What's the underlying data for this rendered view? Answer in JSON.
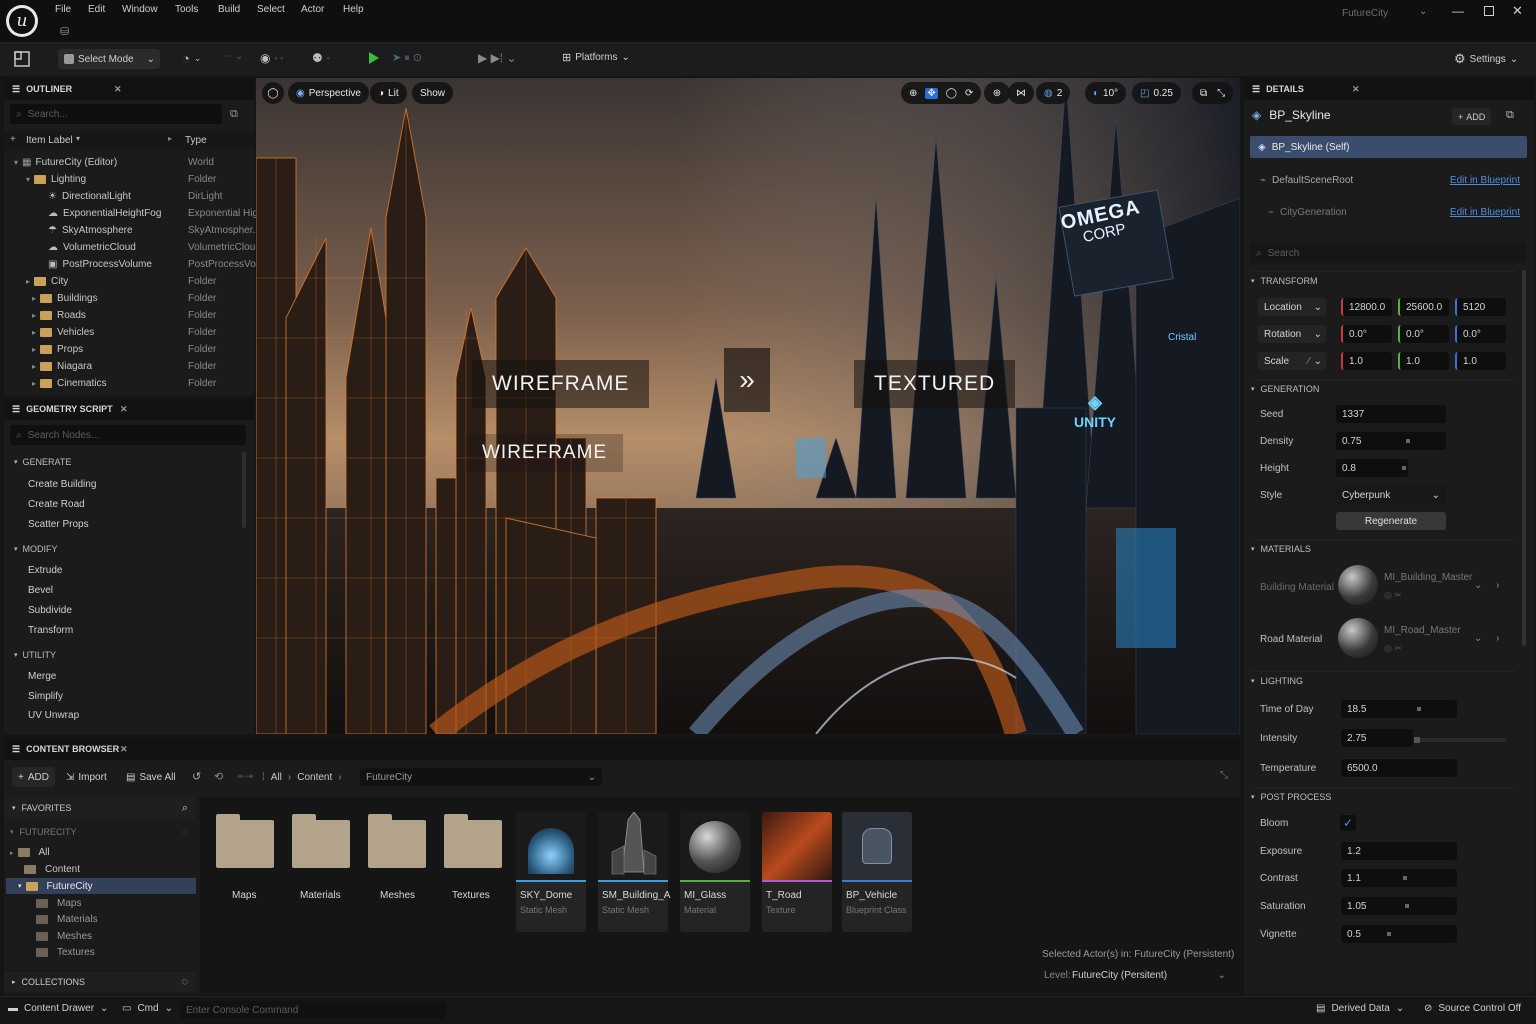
{
  "window": {
    "title": "FutureCity"
  },
  "menus": [
    "File",
    "Edit",
    "Window",
    "Tools",
    "Build",
    "Select",
    "Actor",
    "Help"
  ],
  "toolbar": {
    "select_mode": "Select Mode",
    "platforms": "Platforms",
    "settings": "Settings"
  },
  "outliner": {
    "title": "OUTLINER",
    "search_placeholder": "Search...",
    "col_label": "Item Label",
    "col_type": "Type",
    "rows": [
      {
        "label": "FutureCity (Editor)",
        "type": "World"
      },
      {
        "label": "Lighting",
        "type": "Folder"
      },
      {
        "label": "DirectionalLight",
        "type": "DirLight"
      },
      {
        "label": "ExponentialHeightFog",
        "type": "Exponential Hig"
      },
      {
        "label": "SkyAtmosphere",
        "type": "SkyAtmospher..."
      },
      {
        "label": "VolumetricCloud",
        "type": "VolumetricClou"
      },
      {
        "label": "PostProcessVolume",
        "type": "PostProcessVol"
      },
      {
        "label": "City",
        "type": "Folder"
      },
      {
        "label": "Buildings",
        "type": "Folder"
      },
      {
        "label": "Roads",
        "type": "Folder"
      },
      {
        "label": "Vehicles",
        "type": "Folder"
      },
      {
        "label": "Props",
        "type": "Folder"
      },
      {
        "label": "Niagara",
        "type": "Folder"
      },
      {
        "label": "Cinematics",
        "type": "Folder"
      }
    ]
  },
  "geometry_script": {
    "title": "GEOMETRY SCRIPT",
    "search_placeholder": "Search Nodes...",
    "sections": [
      {
        "name": "GENERATE",
        "items": [
          "Create Building",
          "Create Road",
          "Scatter Props"
        ]
      },
      {
        "name": "MODIFY",
        "items": [
          "Extrude",
          "Bevel",
          "Subdivide",
          "Transform"
        ]
      },
      {
        "name": "UTILITY",
        "items": [
          "Merge",
          "Simplify",
          "UV Unwrap"
        ]
      }
    ]
  },
  "viewport": {
    "perspective": "Perspective",
    "lit": "Lit",
    "show": "Show",
    "snap_grid": "2",
    "snap_angle": "10°",
    "snap_scale": "0.25",
    "label_wireframe": "WIREFRAME",
    "label_wireframe_2": "WIREFRAME",
    "label_textured": "TEXTURED",
    "sign_omega_1": "OMEGA",
    "sign_omega_2": "CORP",
    "sign_unity": "UNITY",
    "sign_small": "Cristal"
  },
  "details": {
    "title": "DETAILS",
    "actor": "BP_Skyline",
    "add": "ADD",
    "self": "BP_Skyline (Self)",
    "components": [
      {
        "name": "DefaultSceneRoot",
        "link": "Edit in Blueprint"
      },
      {
        "name": "CityGeneration",
        "link": "Edit in Blueprint"
      }
    ],
    "search_placeholder": "Search",
    "transform": {
      "title": "TRANSFORM",
      "location_label": "Location",
      "location": [
        "12800.0",
        "25600.0",
        "5120"
      ],
      "rotation_label": "Rotation",
      "rotation": [
        "0.0°",
        "0.0°",
        "0.0°"
      ],
      "scale_label": "Scale",
      "scale": [
        "1.0",
        "1.0",
        "1.0"
      ]
    },
    "generation": {
      "title": "GENERATION",
      "seed_label": "Seed",
      "seed": "1337",
      "density_label": "Density",
      "density": "0.75",
      "height_label": "Height",
      "height": "0.8",
      "style_label": "Style",
      "style": "Cyberpunk",
      "regenerate": "Regenerate"
    },
    "materials": {
      "title": "MATERIALS",
      "building_label": "Building Material",
      "building": "MI_Building_Master",
      "road_label": "Road Material",
      "road": "MI_Road_Master"
    },
    "lighting": {
      "title": "LIGHTING",
      "tod_label": "Time of Day",
      "tod": "18.5",
      "intensity_label": "Intensity",
      "intensity": "2.75",
      "temperature_label": "Temperature",
      "temperature": "6500.0"
    },
    "post_process": {
      "title": "POST PROCESS",
      "bloom_label": "Bloom",
      "exposure_label": "Exposure",
      "exposure": "1.2",
      "contrast_label": "Contrast",
      "contrast": "1.1",
      "saturation_label": "Saturation",
      "saturation": "1.05",
      "vignette_label": "Vignette",
      "vignette": "0.5"
    }
  },
  "content_browser": {
    "title": "CONTENT BROWSER",
    "add": "ADD",
    "import": "Import",
    "save_all": "Save All",
    "crumbs": [
      "All",
      "Content"
    ],
    "path": "FutureCity",
    "favorites": "FAVORITES",
    "futurecity": "FUTURECITY",
    "tree": [
      "All",
      "Content",
      "FutureCity",
      "Maps",
      "Materials",
      "Meshes",
      "Textures"
    ],
    "collections": "COLLECTIONS",
    "folders": [
      "Maps",
      "Materials",
      "Meshes",
      "Textures"
    ],
    "assets": [
      {
        "name": "SKY_Dome",
        "type": "Static Mesh"
      },
      {
        "name": "SM_Building_A",
        "type": "Static Mesh"
      },
      {
        "name": "MI_Glass",
        "type": "Material"
      },
      {
        "name": "T_Road",
        "type": "Texture"
      },
      {
        "name": "BP_Vehicle",
        "type": "Blueprint Class"
      }
    ],
    "selected_status": "Selected Actor(s) in: FutureCity (Persistent)",
    "level_label": "Level:",
    "level": "FutureCity (Persitent)"
  },
  "statusbar": {
    "content_drawer": "Content Drawer",
    "cmd": "Cmd",
    "console_placeholder": "Enter Console Command",
    "derived_data": "Derived Data",
    "source_control": "Source Control Off"
  }
}
